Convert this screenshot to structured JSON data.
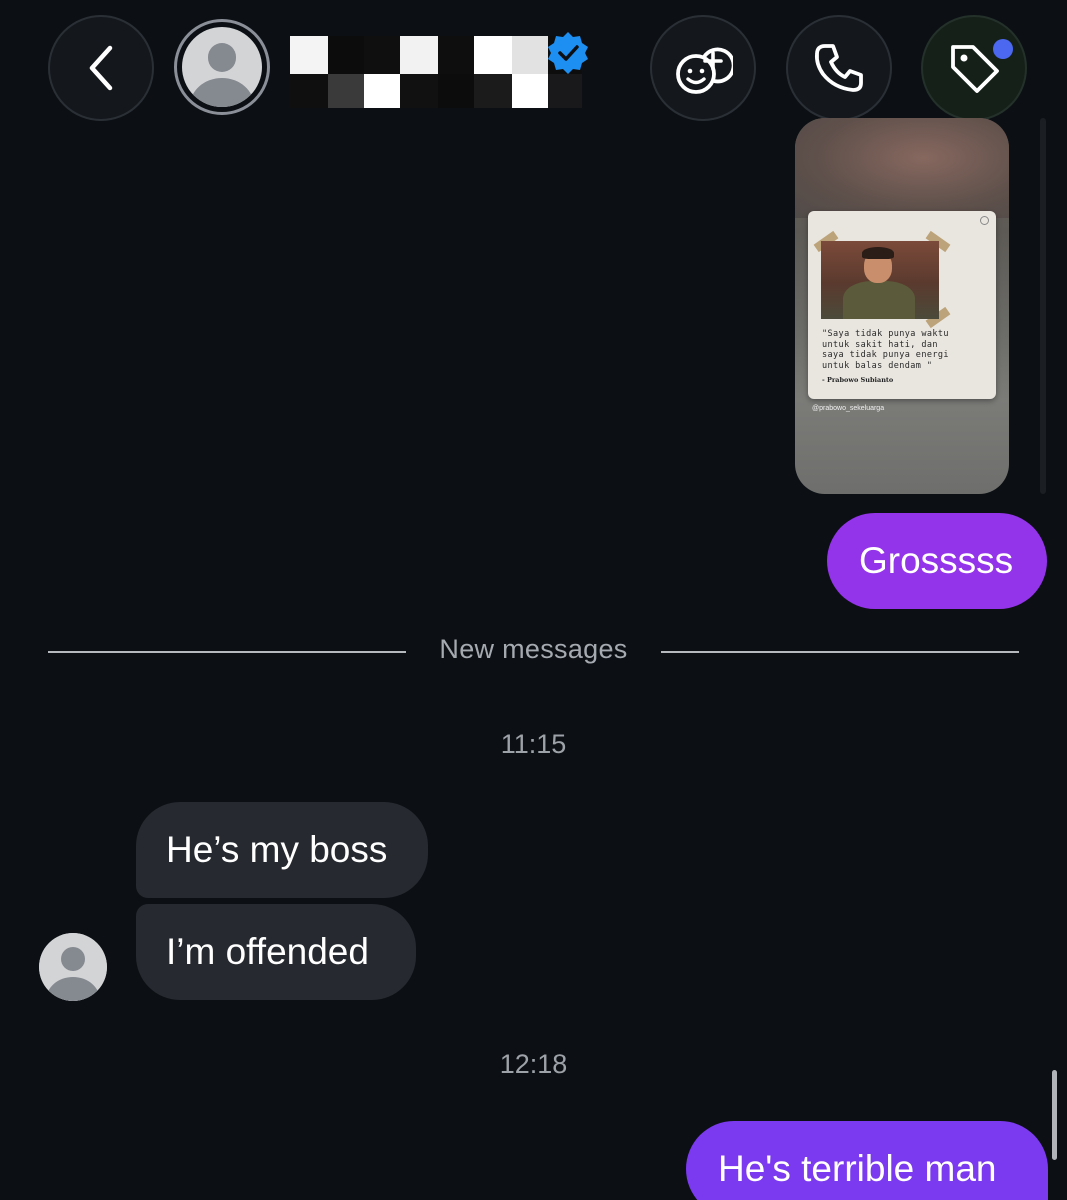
{
  "header": {
    "back_icon": "chevron-left-icon",
    "verified_icon": "verified-badge-icon",
    "effects_icon": "face-plus-icon",
    "call_icon": "phone-icon",
    "tag_icon": "tag-icon",
    "tag_notification_color": "#4c68f0"
  },
  "story_reply": {
    "quote_lines": "\"Saya tidak punya waktu\nuntuk sakit hati, dan\nsaya tidak punya energi\nuntuk balas dendam \"",
    "quote_author": "- Prabowo Subianto",
    "handle": "@prabowo_sekeluarga"
  },
  "messages": {
    "outgoing_1": "Grosssss",
    "divider": "New messages",
    "time_1": "11:15",
    "incoming_1": "He’s my boss",
    "incoming_2": "I’m offended",
    "time_2": "12:18",
    "outgoing_2": "He's terrible man"
  },
  "colors": {
    "background": "#0c1014",
    "outgoing_bubble": "#9333ea",
    "outgoing_bubble_latest": "#7c3af0",
    "incoming_bubble": "#262a30"
  }
}
